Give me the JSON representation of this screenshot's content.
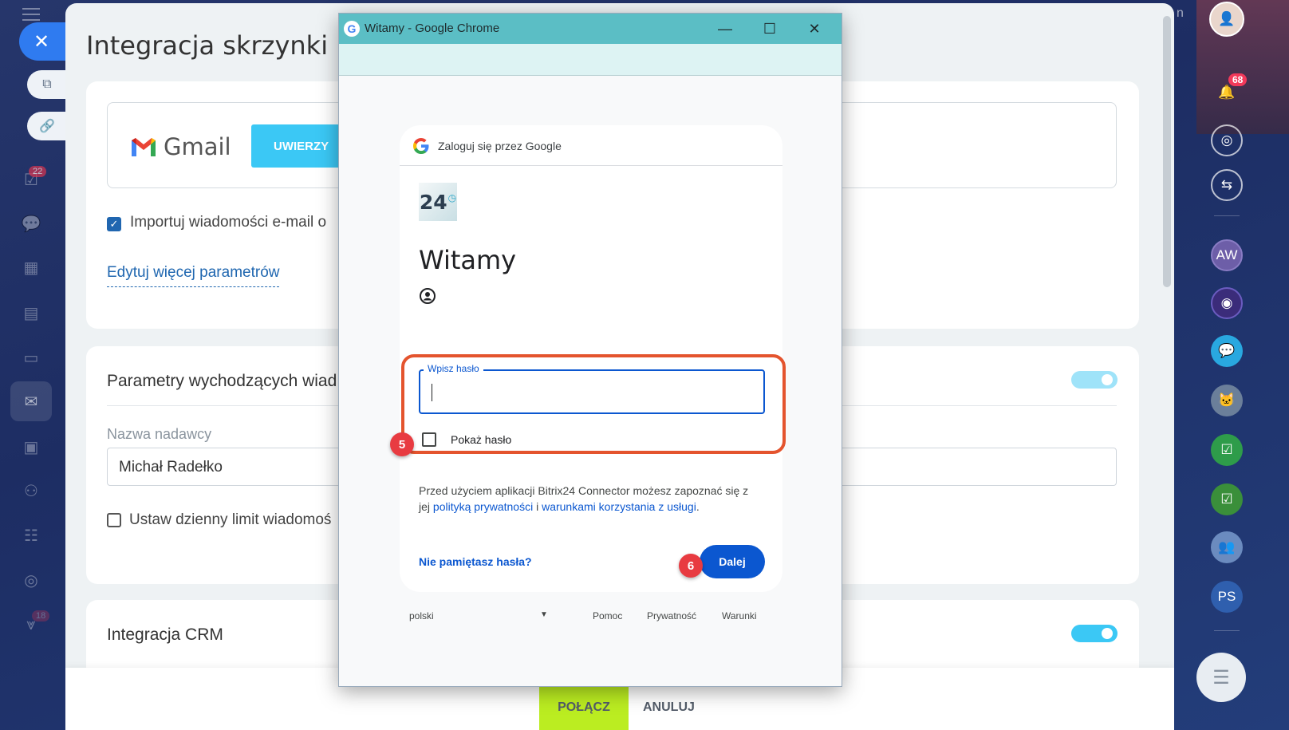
{
  "left_sidebar": {
    "tasks_badge": "22",
    "faded_badge": "18",
    "icons": [
      "checklist-icon",
      "chat-icon",
      "calendar-icon",
      "document-icon",
      "card-icon",
      "mail-icon",
      "monitor-icon",
      "people-icon",
      "list-icon",
      "target-icon",
      "funnel-icon"
    ]
  },
  "panel": {
    "title": "Integracja skrzynki p",
    "gmail_label": "Gmail",
    "auth_button": "UWIERZY",
    "import_checkbox_label": "Importuj wiadomości e-mail o",
    "edit_params_link": "Edytuj więcej parametrów",
    "outgoing_title": "Parametry wychodzących wiad",
    "sender_name_label": "Nazwa nadawcy",
    "sender_name_value": "Michał Radełko",
    "daily_limit_label": "Ustaw dzienny limit wiadomoś",
    "crm_title": "Integracja CRM",
    "connect_button": "POŁĄCZ",
    "cancel_button": "ANULUJ"
  },
  "right_sidebar": {
    "top_fragment": "n",
    "notification_badge": "68",
    "avatars": [
      "AW",
      "PS"
    ]
  },
  "chrome_window": {
    "title": "Witamy - Google Chrome",
    "controls": [
      "minimize-icon",
      "maximize-icon",
      "close-icon"
    ]
  },
  "google_signin": {
    "header": "Zaloguj się przez Google",
    "app_logo_text": "24",
    "heading": "Witamy",
    "password_label": "Wpisz hasło",
    "password_value": "",
    "show_password_label": "Pokaż hasło",
    "info_prefix": "Przed użyciem aplikacji Bitrix24 Connector możesz zapoznać się z jej ",
    "privacy_link": "polityką prywatności",
    "info_mid": " i ",
    "terms_link": "warunkami korzystania z usługi",
    "info_suffix": ".",
    "forgot_link": "Nie pamiętasz hasła?",
    "next_button": "Dalej",
    "footer": {
      "language": "polski",
      "help": "Pomoc",
      "privacy": "Prywatność",
      "terms": "Warunki"
    }
  },
  "annotations": {
    "step_password": "5",
    "step_next": "6",
    "highlight_color": "#e4542e",
    "marker_color": "#e83b41"
  },
  "colors": {
    "accent_blue": "#3bc8f5",
    "google_blue": "#0b57d0",
    "connect_green": "#bbed21",
    "chrome_titlebar": "#5bbec5"
  }
}
